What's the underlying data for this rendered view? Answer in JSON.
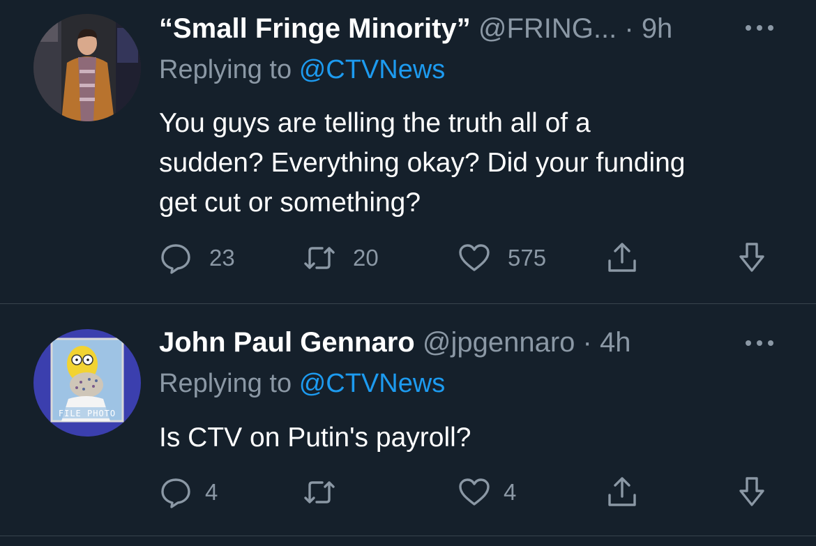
{
  "tweets": [
    {
      "display_name": "“Small Fringe Minority”",
      "handle": "@FRING...",
      "separator": "·",
      "time": "9h",
      "replying_prefix": "Replying to",
      "replying_to": "@CTVNews",
      "body_lines": [
        "You guys are telling the truth all of a",
        "sudden? Everything okay? Did your funding",
        "get cut or something?"
      ],
      "counts": {
        "replies": "23",
        "retweets": "20",
        "likes": "575"
      },
      "avatar_icon": "person-in-coat-avatar"
    },
    {
      "display_name": "John Paul Gennaro",
      "handle": "@jpgennaro",
      "separator": "·",
      "time": "4h",
      "replying_prefix": "Replying to",
      "replying_to": "@CTVNews",
      "body_lines": [
        "Is CTV on Putin's payroll?"
      ],
      "counts": {
        "replies": "4",
        "retweets": "",
        "likes": "4"
      },
      "avatar_caption": "FILE PHOTO",
      "avatar_icon": "cartoon-character-avatar"
    }
  ],
  "colors": {
    "background": "#15202b",
    "text": "#ffffff",
    "secondary": "#8b98a5",
    "link": "#1d9bf0",
    "divider": "#38444d"
  },
  "icons": [
    "reply-icon",
    "retweet-icon",
    "like-icon",
    "share-icon",
    "download-icon",
    "more-icon"
  ]
}
